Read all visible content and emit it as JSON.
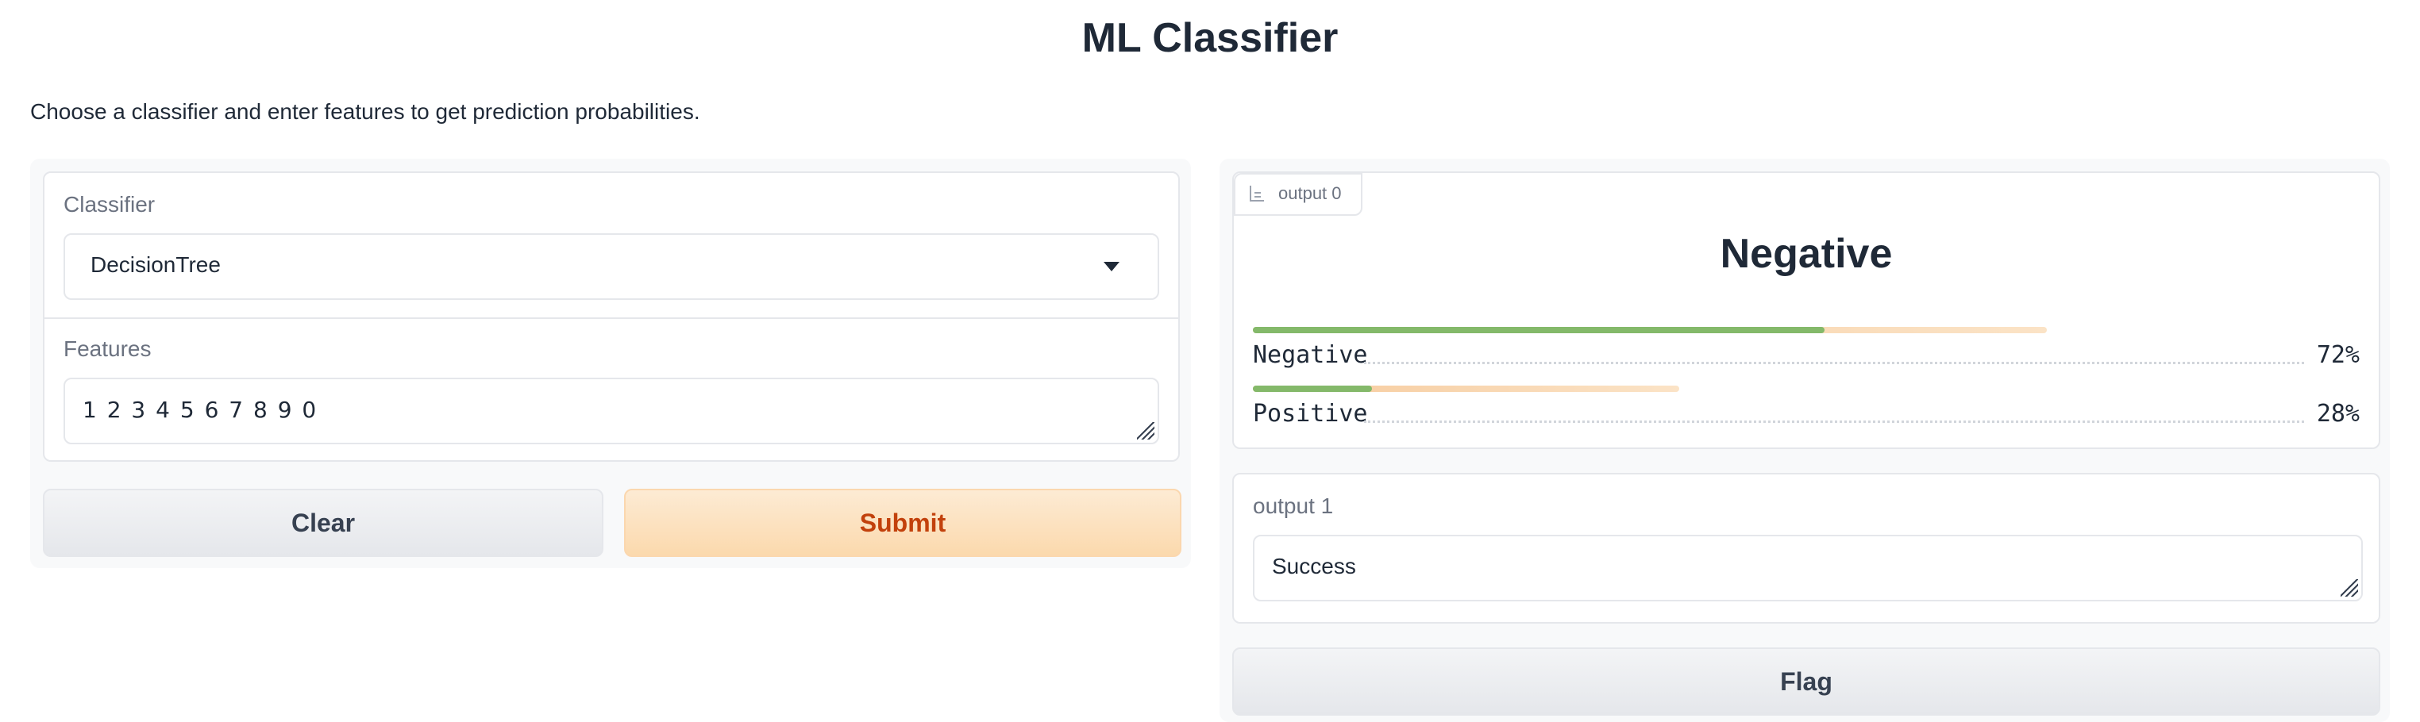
{
  "app": {
    "title": "ML Classifier",
    "description": "Choose a classifier and enter features to get prediction probabilities."
  },
  "inputs": {
    "classifier": {
      "label": "Classifier",
      "value": "DecisionTree"
    },
    "features": {
      "label": "Features",
      "value": "1 2 3 4 5 6 7 8 9 0"
    }
  },
  "buttons": {
    "clear": "Clear",
    "submit": "Submit",
    "flag": "Flag"
  },
  "output0": {
    "tab_label": "output 0",
    "icon": "bar-chart-icon",
    "predicted_label": "Negative",
    "confidences": [
      {
        "label": "Negative",
        "value": 0.72,
        "text": "72%"
      },
      {
        "label": "Positive",
        "value": 0.28,
        "text": "28%"
      }
    ]
  },
  "output1": {
    "label": "output 1",
    "value": "Success"
  },
  "colors": {
    "accent": "#c2410c",
    "bar_fill": "#84b96a",
    "bar_track": "#f6c99a"
  }
}
